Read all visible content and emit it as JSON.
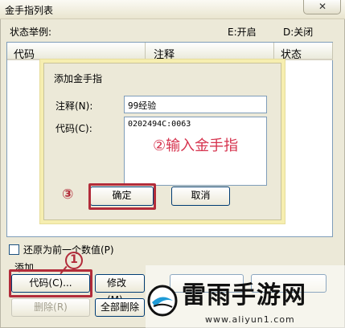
{
  "window": {
    "title": "金手指列表",
    "close_glyph": "✕"
  },
  "legend": {
    "label": "状态举例:",
    "enabled": "E:开启",
    "disabled": "D:关闭"
  },
  "list": {
    "columns": [
      "代码",
      "注释",
      "状态"
    ]
  },
  "options": {
    "restore_label": "还原为前一个数值(P)",
    "restore_checked": false
  },
  "add_section": {
    "label": "添加"
  },
  "buttons": {
    "add_code": "代码(C)...",
    "modify": "修改(M)...",
    "delete": "删除(R)",
    "delete_all": "全部删除"
  },
  "dialog": {
    "title": "添加金手指",
    "note_label": "注释(N):",
    "note_value": "99经验",
    "code_label": "代码(C):",
    "code_value": "0202494C:0063",
    "hint": "②输入金手指",
    "ok": "确定",
    "cancel": "取消"
  },
  "annotations": {
    "marker_1": "1",
    "marker_3": "③",
    "color": "#b22c3a"
  },
  "watermark": {
    "text": "雷雨手游网",
    "url": "www.aliyun1.com"
  }
}
